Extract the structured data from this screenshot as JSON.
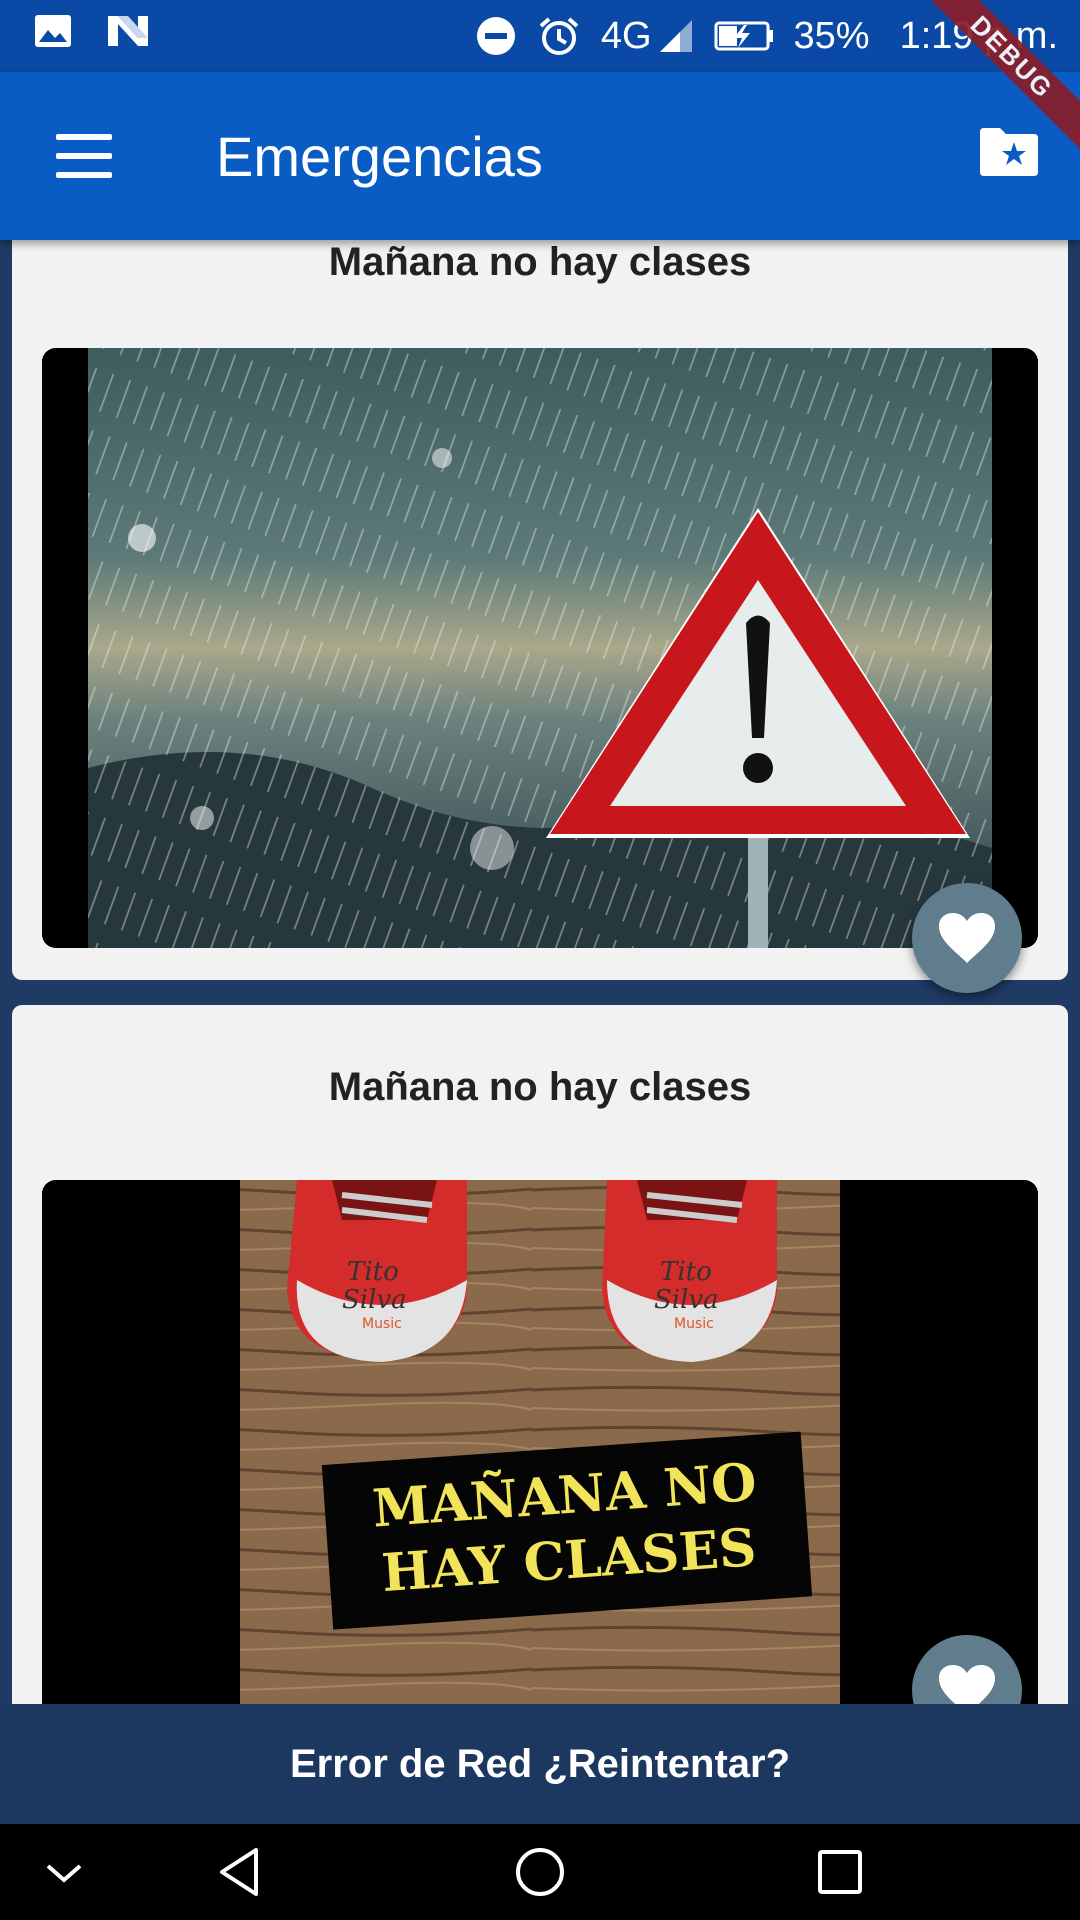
{
  "status_bar": {
    "left_icons": [
      "image-notification-icon",
      "n-logo-notification-icon"
    ],
    "right_icons": [
      "do-not-disturb-icon",
      "alarm-icon",
      "signal-icon",
      "battery-charging-icon"
    ],
    "network": "4G",
    "battery": "35%",
    "time": "1:19 p.m.",
    "debug_label": "DEBUG"
  },
  "app_bar": {
    "title": "Emergencias",
    "menu_icon": "hamburger-menu-icon",
    "action_icon": "folder-star-icon",
    "color": "#0a5cc5"
  },
  "cards": [
    {
      "title": "Mañana no hay clases",
      "image": "storm-warning-sign-photo"
    },
    {
      "title": "Mañana no hay clases",
      "image": "red-sneakers-photo",
      "image_text_line1": "MAÑANA NO",
      "image_text_line2": "HAY CLASES",
      "shoe_brand_1": "Tito",
      "shoe_brand_2": "Silva",
      "shoe_brand_3": "Music"
    }
  ],
  "snackbar": {
    "text": "Error de Red ¿Reintentar?",
    "color": "#1d3860"
  },
  "nav_bar": {
    "buttons": [
      "collapse-icon",
      "back-icon",
      "home-icon",
      "recents-icon"
    ]
  }
}
